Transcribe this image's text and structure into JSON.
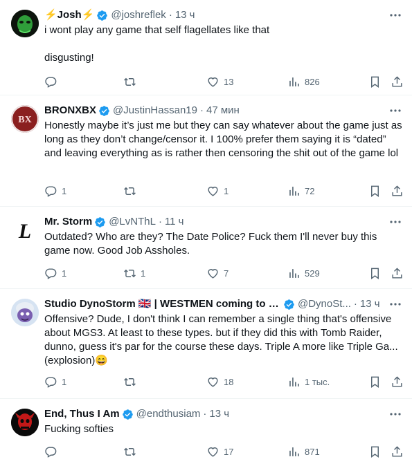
{
  "colors": {
    "verified": "#1d9bf0",
    "secondary": "#536471",
    "divider": "#eff3f4"
  },
  "tweets": [
    {
      "name": "⚡Josh⚡",
      "handle": "@joshreflek",
      "time": "13 ч",
      "text": "i wont play any game that self flagellates like that\n\ndisgusting!",
      "replies": "",
      "retweets": "",
      "likes": "13",
      "views": "826",
      "avatar_icon": "green-mask-avatar"
    },
    {
      "name": "BRONXBX",
      "handle": "@JustinHassan19",
      "time": "47 мин",
      "text": "Honestly maybe it’s just me but they can say whatever about the game just as long as they don’t change/censor it. I 100% prefer them saying it is “dated” and leaving everything as is rather then censoring the shit out of the game lol",
      "replies": "1",
      "retweets": "",
      "likes": "1",
      "views": "72",
      "avatar_icon": "bx-logo-avatar",
      "avatar_text": "BX"
    },
    {
      "name": "Mr. Storm",
      "handle": "@LvNThL",
      "time": "11 ч",
      "text": "Outdated? Who are they? The Date Police? Fuck them I'll never buy this game now. Good Job Assholes.",
      "replies": "1",
      "retweets": "1",
      "likes": "7",
      "views": "529",
      "avatar_icon": "gothic-l-avatar",
      "avatar_text": "L"
    },
    {
      "name": "Studio DynoStorm 🇬🇧 | WESTMEN coming to S...",
      "handle": "@DynoSt...",
      "time": "13 ч",
      "text": "Offensive? Dude, I don't think I can remember a single thing that's offensive about MGS3. At least to these types. but if they did this with Tomb Raider, dunno, guess it's par for the course these days. Triple A more like Triple Ga... (explosion)😄",
      "replies": "1",
      "retweets": "",
      "likes": "18",
      "views": "1 тыс.",
      "avatar_icon": "cartoon-character-avatar"
    },
    {
      "name": "End, Thus I Am",
      "handle": "@endthusiam",
      "time": "13 ч",
      "text": "Fucking softies",
      "replies": "",
      "retweets": "",
      "likes": "17",
      "views": "871",
      "avatar_icon": "red-skull-avatar"
    }
  ]
}
